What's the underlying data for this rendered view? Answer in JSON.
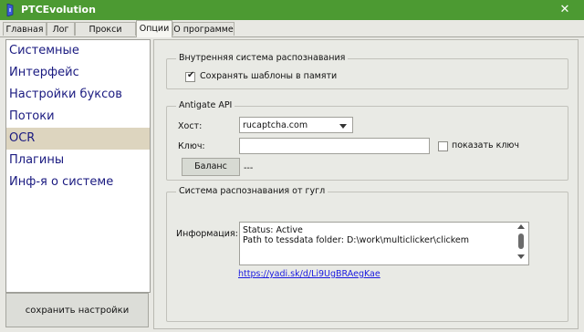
{
  "window": {
    "title": "PTCEvolution",
    "close_glyph": "✕"
  },
  "tabs": [
    {
      "label": "Главная"
    },
    {
      "label": "Лог"
    },
    {
      "label": "Прокси чекер"
    },
    {
      "label": "Опции",
      "active": true
    },
    {
      "label": "О программе"
    }
  ],
  "sidebar": {
    "items": [
      {
        "label": "Системные"
      },
      {
        "label": "Интерфейс"
      },
      {
        "label": "Настройки буксов"
      },
      {
        "label": "Потоки"
      },
      {
        "label": "OCR",
        "active": true
      },
      {
        "label": "Плагины"
      },
      {
        "label": "Инф-я о системе"
      }
    ],
    "save_label": "сохранить настройки"
  },
  "internal_recognition": {
    "title": "Внутренняя система распознавания",
    "save_templates_label": "Сохранять шаблоны в памяти",
    "save_templates_checked": true
  },
  "antigate": {
    "title": "Antigate API",
    "host_label": "Хост:",
    "host_value": "rucaptcha.com",
    "key_label": "Ключ:",
    "key_value": "",
    "show_key_label": "показать ключ",
    "show_key_checked": false,
    "balance_button": "Баланс",
    "balance_value": "---"
  },
  "google_recognition": {
    "title": "Система распознавания от гугл",
    "info_label": "Информация:",
    "info_lines": [
      "Status: Active",
      "Path to tessdata folder: D:\\work\\multiclicker\\clickem"
    ],
    "link": "https://yadi.sk/d/Li9UgBRAegKae"
  },
  "colors": {
    "titlebar": "#4c9a32",
    "sidebar_active": "#ddd5bf",
    "sidebar_text": "#1a1a80",
    "link": "#1a1ae0"
  }
}
